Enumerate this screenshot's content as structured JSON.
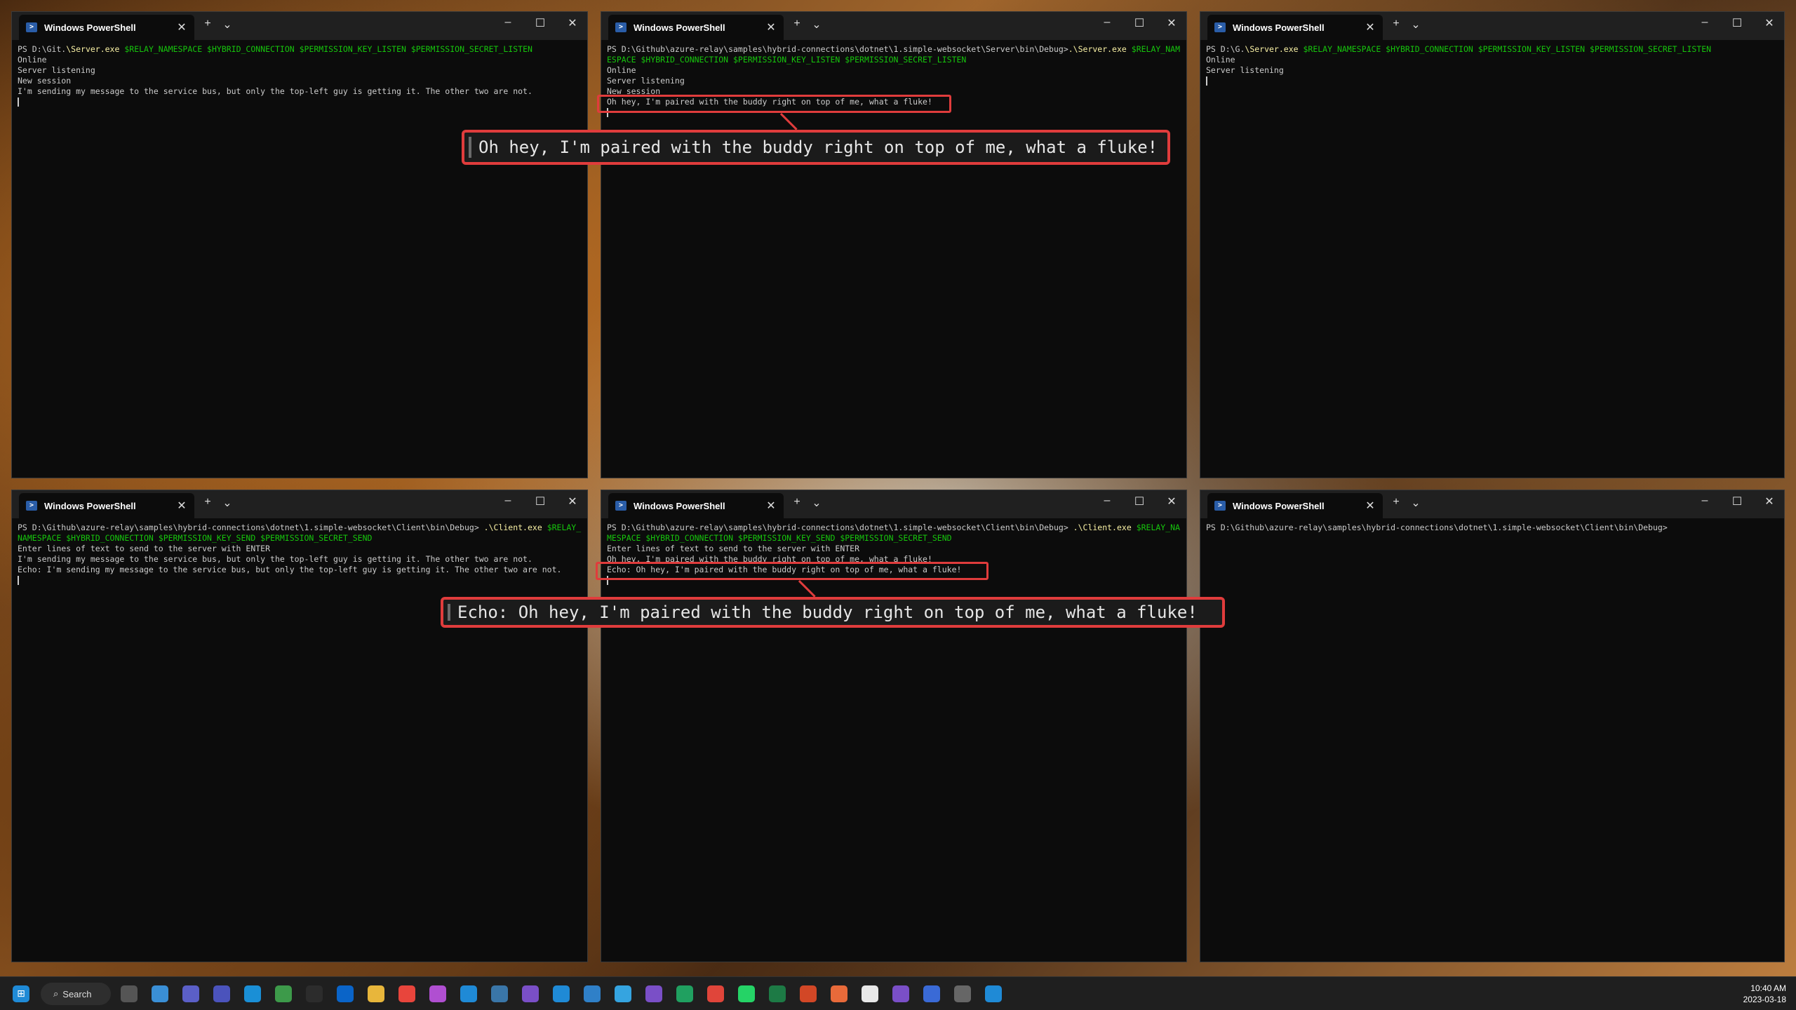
{
  "tab_label": "Windows PowerShell",
  "window_controls": {
    "new_tab": "+",
    "dropdown": "⌄",
    "minimize": "–",
    "maximize": "☐",
    "close": "✕",
    "tab_close": "✕"
  },
  "windows": [
    {
      "lines": [
        [
          {
            "t": "PS D:\\Git.",
            "c": ""
          },
          {
            "t": "\\Server.exe",
            "c": "y"
          },
          {
            "t": " $RELAY_NAMESPACE $HYBRID_CONNECTION $PERMISSION_KEY_LISTEN $PERMISSION_SECRET_LISTEN",
            "c": "g"
          }
        ],
        [
          {
            "t": "Online",
            "c": ""
          }
        ],
        [
          {
            "t": "Server listening",
            "c": ""
          }
        ],
        [
          {
            "t": "New session",
            "c": ""
          }
        ],
        [
          {
            "t": "I'm sending my message to the service bus, but only the top-left guy is getting it. The other two are not.",
            "c": ""
          }
        ]
      ]
    },
    {
      "lines": [
        [
          {
            "t": "PS D:\\Github\\azure-relay\\samples\\hybrid-connections\\dotnet\\1.simple-websocket\\Server\\bin\\Debug>",
            "c": ""
          },
          {
            "t": ".\\Server.exe",
            "c": "y"
          },
          {
            "t": " $RELAY_NAMESPACE $HYBRID_CONNECTION $PERMISSION_KEY_LISTEN $PERMISSION_SECRET_LISTEN",
            "c": "g"
          }
        ],
        [
          {
            "t": "Online",
            "c": ""
          }
        ],
        [
          {
            "t": "Server listening",
            "c": ""
          }
        ],
        [
          {
            "t": "New session",
            "c": ""
          }
        ],
        [
          {
            "t": "Oh hey, I'm paired with the buddy right on top of me, what a fluke!",
            "c": ""
          }
        ]
      ]
    },
    {
      "lines": [
        [
          {
            "t": "PS D:\\G.",
            "c": ""
          },
          {
            "t": "\\Server.exe",
            "c": "y"
          },
          {
            "t": " $RELAY_NAMESPACE $HYBRID_CONNECTION $PERMISSION_KEY_LISTEN $PERMISSION_SECRET_LISTEN",
            "c": "g"
          }
        ],
        [
          {
            "t": "Online",
            "c": ""
          }
        ],
        [
          {
            "t": "Server listening",
            "c": ""
          }
        ]
      ]
    },
    {
      "lines": [
        [
          {
            "t": "PS D:\\Github\\azure-relay\\samples\\hybrid-connections\\dotnet\\1.simple-websocket\\Client\\bin\\Debug> ",
            "c": ""
          },
          {
            "t": ".\\Client.exe",
            "c": "y"
          },
          {
            "t": " $RELAY_NAMESPACE $HYBRID_CONNECTION $PERMISSION_KEY_SEND $PERMISSION_SECRET_SEND",
            "c": "g"
          }
        ],
        [
          {
            "t": "Enter lines of text to send to the server with ENTER",
            "c": ""
          }
        ],
        [
          {
            "t": "I'm sending my message to the service bus, but only the top-left guy is getting it. The other two are not.",
            "c": ""
          }
        ],
        [
          {
            "t": "Echo: I'm sending my message to the service bus, but only the top-left guy is getting it. The other two are not.",
            "c": ""
          }
        ]
      ]
    },
    {
      "lines": [
        [
          {
            "t": "PS D:\\Github\\azure-relay\\samples\\hybrid-connections\\dotnet\\1.simple-websocket\\Client\\bin\\Debug> ",
            "c": ""
          },
          {
            "t": ".\\Client.exe",
            "c": "y"
          },
          {
            "t": " $RELAY_NAMESPACE $HYBRID_CONNECTION $PERMISSION_KEY_SEND $PERMISSION_SECRET_SEND",
            "c": "g"
          }
        ],
        [
          {
            "t": "Enter lines of text to send to the server with ENTER",
            "c": ""
          }
        ],
        [
          {
            "t": "Oh hey, I'm paired with the buddy right on top of me, what a fluke!",
            "c": ""
          }
        ],
        [
          {
            "t": "Echo: Oh hey, I'm paired with the buddy right on top of me, what a fluke!",
            "c": ""
          }
        ]
      ]
    },
    {
      "lines": [
        [
          {
            "t": "PS D:\\Github\\azure-relay\\samples\\hybrid-connections\\dotnet\\1.simple-websocket\\Client\\bin\\Debug>",
            "c": ""
          }
        ]
      ]
    }
  ],
  "callouts": {
    "top": "Oh hey, I'm paired with the buddy right on top of me, what a fluke!",
    "bottom": "Echo: Oh hey, I'm paired with the buddy right on top of me, what a fluke!"
  },
  "taskbar": {
    "search_label": "Search",
    "time": "10:40 AM",
    "date": "2023-03-18",
    "icons": [
      {
        "name": "task-view-icon",
        "color": "#555"
      },
      {
        "name": "weather-icon",
        "color": "#3a8fd6"
      },
      {
        "name": "teams-chat-icon",
        "color": "#5b5fc7"
      },
      {
        "name": "teams-icon",
        "color": "#4b53bc"
      },
      {
        "name": "edge-icon",
        "color": "#1a8fd6"
      },
      {
        "name": "notepad-icon",
        "color": "#3d9a4a"
      },
      {
        "name": "terminal-icon",
        "color": "#2c2c2c"
      },
      {
        "name": "outlook-icon",
        "color": "#0a64c8"
      },
      {
        "name": "file-explorer-icon",
        "color": "#e8b63b"
      },
      {
        "name": "chrome-icon",
        "color": "#e8453c"
      },
      {
        "name": "paint-icon",
        "color": "#b04fd1"
      },
      {
        "name": "vscode-icon",
        "color": "#1f8ad6"
      },
      {
        "name": "python-icon",
        "color": "#3a76a8"
      },
      {
        "name": "visual-studio-icon",
        "color": "#7a4fc7"
      },
      {
        "name": "store-icon",
        "color": "#1f8ad6"
      },
      {
        "name": "snipping-icon",
        "color": "#2f80c8"
      },
      {
        "name": "telegram-icon",
        "color": "#35a4e0"
      },
      {
        "name": "github-icon",
        "color": "#7a4fc7"
      },
      {
        "name": "clock-app-icon",
        "color": "#20a060"
      },
      {
        "name": "sublime-icon",
        "color": "#e0453a"
      },
      {
        "name": "whatsapp-icon",
        "color": "#25d366"
      },
      {
        "name": "excel-icon",
        "color": "#1d7a45"
      },
      {
        "name": "powerpoint-icon",
        "color": "#d24726"
      },
      {
        "name": "pen-icon",
        "color": "#e86a3a"
      },
      {
        "name": "word-icon",
        "color": "#e8e8e8"
      },
      {
        "name": "clapper-icon",
        "color": "#7a4fc7"
      },
      {
        "name": "remote-icon",
        "color": "#3a6ad6"
      },
      {
        "name": "settings-icon",
        "color": "#666"
      },
      {
        "name": "window-icon",
        "color": "#1f8ad6"
      }
    ]
  }
}
